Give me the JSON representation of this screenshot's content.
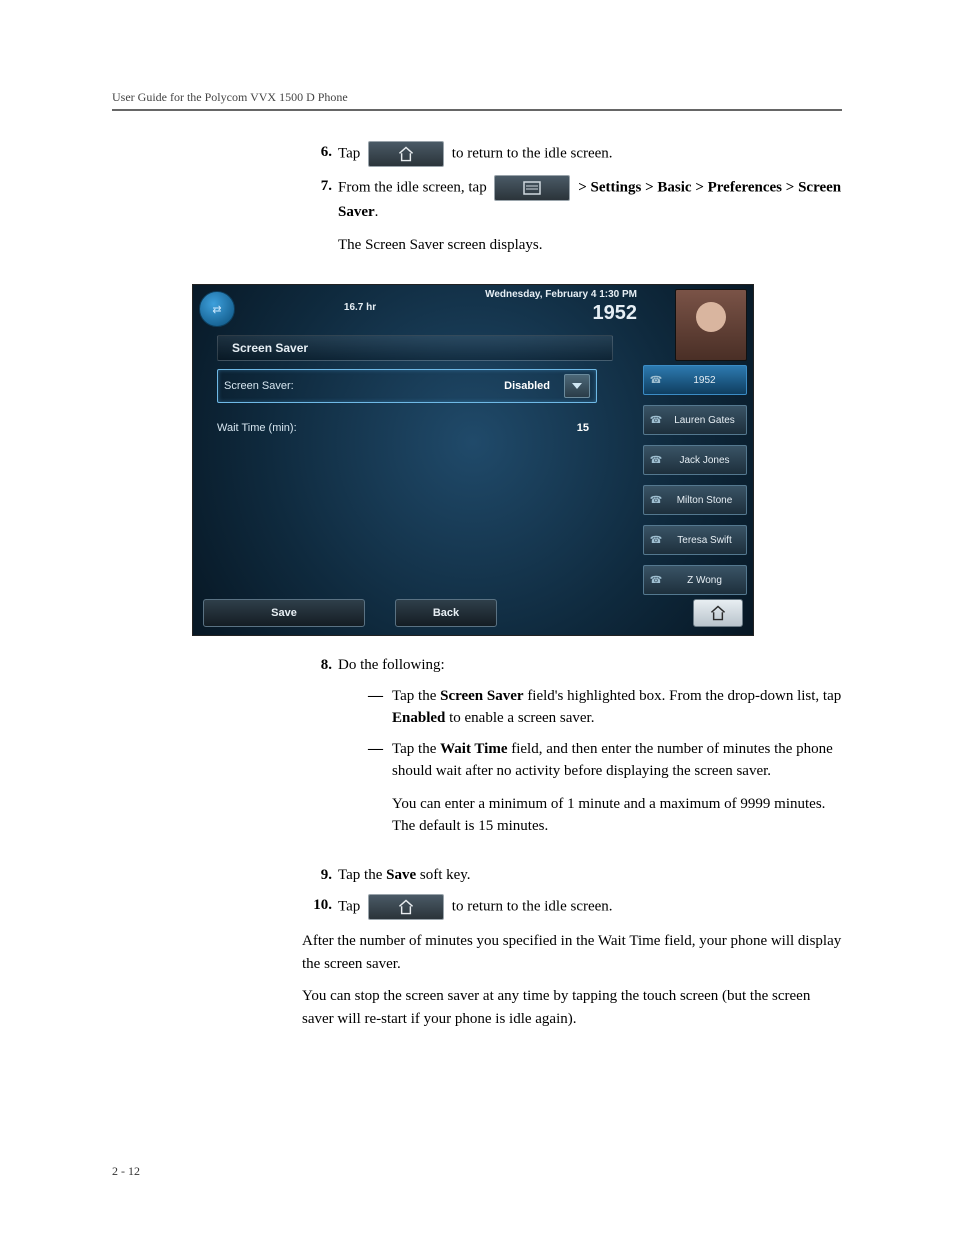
{
  "header": "User Guide for the Polycom VVX 1500 D Phone",
  "footer": "2 - 12",
  "steps": {
    "s6": {
      "num": "6.",
      "a": "Tap ",
      "b": " to return to the idle screen."
    },
    "s7": {
      "num": "7.",
      "a": "From the idle screen, tap ",
      "b_path": " > Settings > Basic > Preferences > Screen Saver",
      "c": ".",
      "result": "The Screen Saver screen displays."
    },
    "s8": {
      "num": "8.",
      "lead": "Do the following:",
      "bul1": {
        "a": "Tap the ",
        "b": "Screen Saver",
        "c": " field's highlighted box. From the drop-down list, tap ",
        "d": "Enabled",
        "e": " to enable a screen saver."
      },
      "bul2": {
        "a": "Tap the ",
        "b": "Wait Time",
        "c": " field, and then enter the number of minutes the phone should wait after no activity before displaying the screen saver.",
        "note": "You can enter a minimum of 1 minute and a maximum of 9999 minutes. The default is 15 minutes."
      }
    },
    "s9": {
      "num": "9.",
      "a": "Tap the ",
      "b": "Save",
      "c": " soft key."
    },
    "s10": {
      "num": "10.",
      "a": "Tap ",
      "b": " to return to the idle screen."
    }
  },
  "after1": "After the number of minutes you specified in the Wait Time field, your phone will display the screen saver.",
  "after2": "You can stop the screen saver at any time by tapping the touch screen (but the screen saver will re-start if your phone is idle again).",
  "phone": {
    "top_center": "16.7 hr",
    "top_time": "Wednesday, February 4  1:30 PM",
    "top_ext": "1952",
    "title": "Screen Saver",
    "field1": {
      "label": "Screen Saver:",
      "value": "Disabled"
    },
    "field2": {
      "label": "Wait Time (min):",
      "value": "15"
    },
    "side": [
      "1952",
      "Lauren Gates",
      "Jack Jones",
      "Milton Stone",
      "Teresa Swift",
      "Z Wong"
    ],
    "save": "Save",
    "back": "Back"
  }
}
